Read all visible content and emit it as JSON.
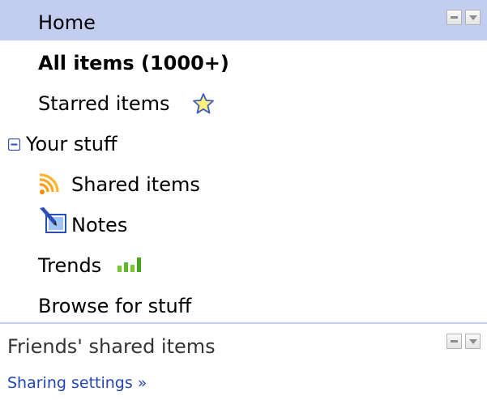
{
  "nav": {
    "home": {
      "label": "Home"
    },
    "all_items": {
      "label": "All items (1000+)"
    },
    "starred": {
      "label": "Starred items",
      "icon": "star-icon"
    },
    "your_stuff": {
      "label": "Your stuff",
      "icon": "collapse-minus-icon"
    },
    "shared_items": {
      "label": "Shared items",
      "icon": "broadcast-icon"
    },
    "notes": {
      "label": "Notes",
      "icon": "note-pencil-icon"
    },
    "trends": {
      "label": "Trends",
      "icon": "bar-chart-icon"
    },
    "browse": {
      "label": "Browse for stuff"
    }
  },
  "friends": {
    "label": "Friends' shared items"
  },
  "sharing_settings": {
    "label": "Sharing settings »"
  },
  "colors": {
    "selected_bg": "#c3cdef",
    "link": "#2244bb",
    "divider": "#c3cdef"
  }
}
